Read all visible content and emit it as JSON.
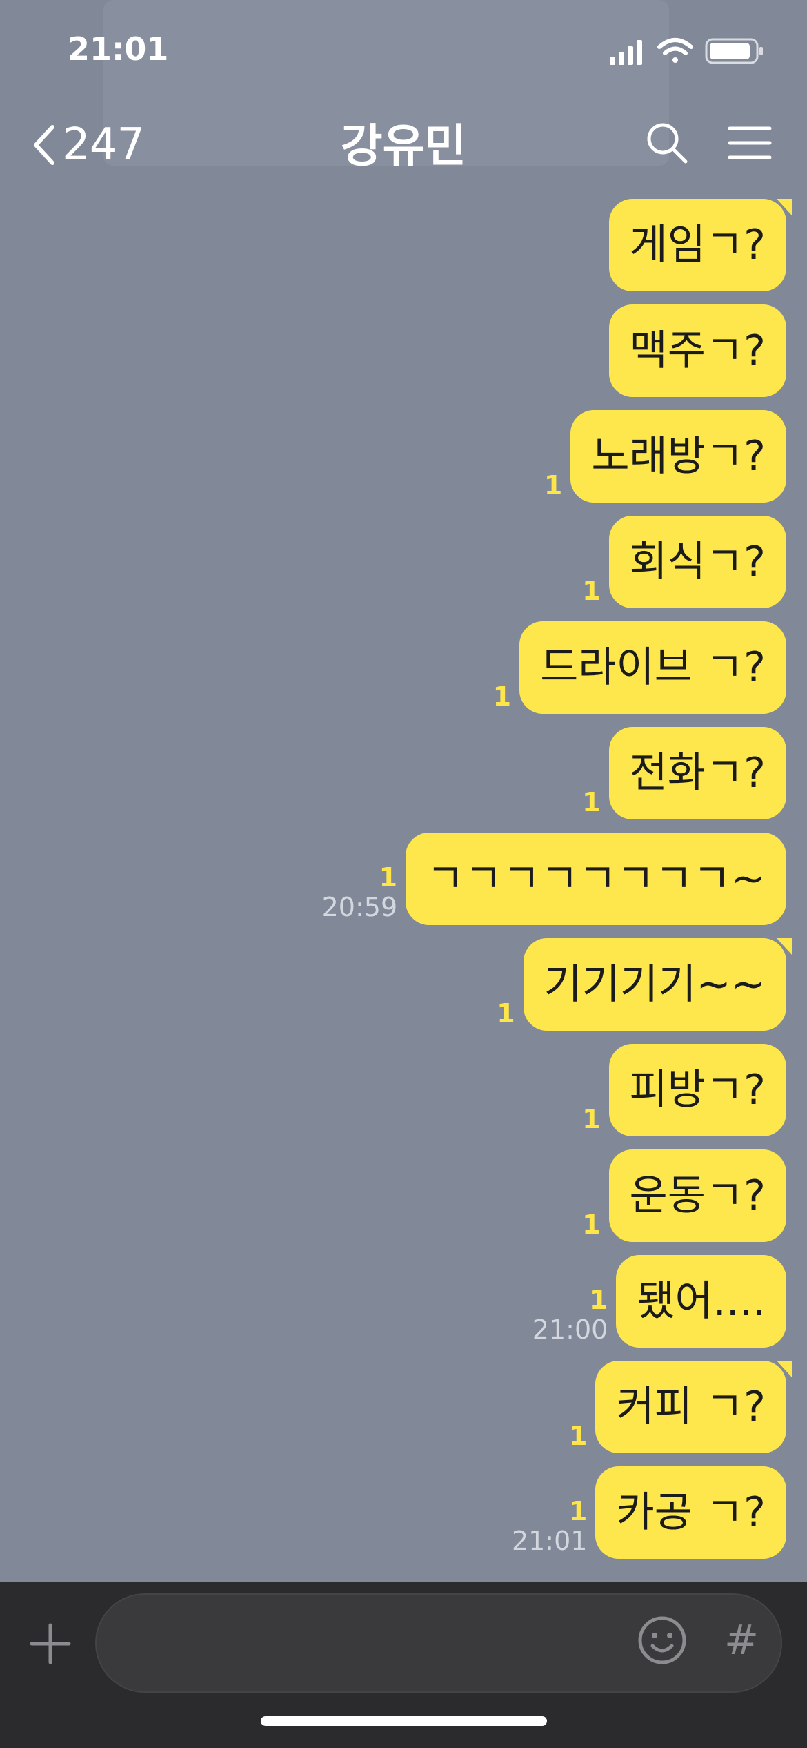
{
  "status_bar": {
    "time": "21:01"
  },
  "header": {
    "back_count": "247",
    "title": "강유민"
  },
  "colors": {
    "background": "#818999",
    "bubble": "#fde74c",
    "unread": "#fde54a",
    "bottom_bar": "#2b2b2d"
  },
  "messages": [
    {
      "text": "게임ㄱ?",
      "unread": "",
      "time": ""
    },
    {
      "text": "맥주ㄱ?",
      "unread": "",
      "time": ""
    },
    {
      "text": "노래방ㄱ?",
      "unread": "1",
      "time": ""
    },
    {
      "text": "회식ㄱ?",
      "unread": "1",
      "time": ""
    },
    {
      "text": "드라이브 ㄱ?",
      "unread": "1",
      "time": ""
    },
    {
      "text": "전화ㄱ?",
      "unread": "1",
      "time": ""
    },
    {
      "text": "ㄱㄱㄱㄱㄱㄱㄱㄱ~",
      "unread": "1",
      "time": "20:59"
    },
    {
      "text": "기기기기~~",
      "unread": "1",
      "time": ""
    },
    {
      "text": "피방ㄱ?",
      "unread": "1",
      "time": ""
    },
    {
      "text": "운동ㄱ?",
      "unread": "1",
      "time": ""
    },
    {
      "text": "됐어....",
      "unread": "1",
      "time": "21:00"
    },
    {
      "text": "커피 ㄱ?",
      "unread": "1",
      "time": ""
    },
    {
      "text": "카공 ㄱ?",
      "unread": "1",
      "time": "21:01"
    }
  ],
  "composer": {
    "value": "",
    "hash_label": "#"
  },
  "icons": [
    "back-chevron-icon",
    "search-icon",
    "menu-icon",
    "plus-icon",
    "emoji-icon",
    "hash-icon",
    "signal-icon",
    "wifi-icon",
    "battery-icon"
  ]
}
